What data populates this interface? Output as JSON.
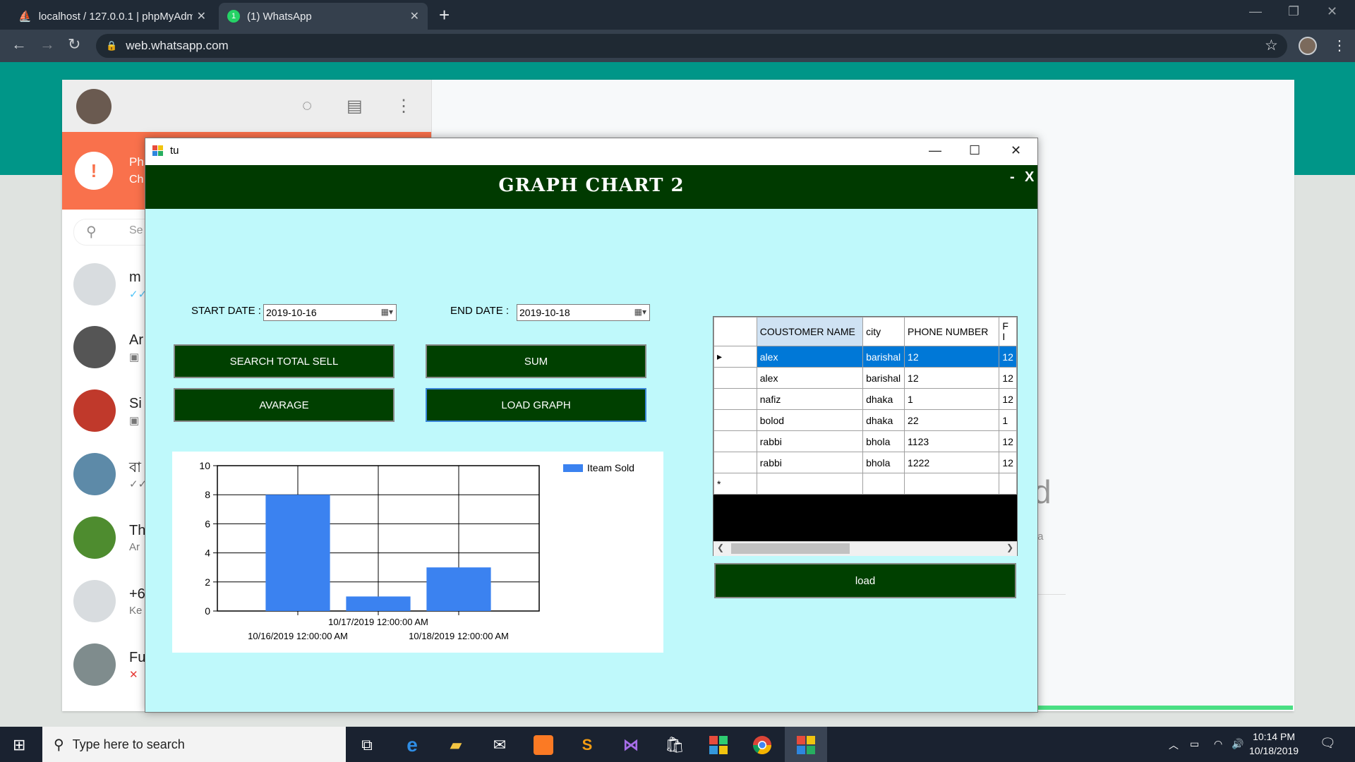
{
  "browser": {
    "tabs": [
      {
        "title": "localhost / 127.0.0.1 | phpMyAdm",
        "active": false
      },
      {
        "title": "(1) WhatsApp",
        "active": true
      }
    ],
    "url": "web.whatsapp.com"
  },
  "whatsapp": {
    "alert": {
      "line1": "Ph",
      "line2": "Ch"
    },
    "search_placeholder": "Se",
    "chats": [
      {
        "name": "m",
        "sub": "✓✓"
      },
      {
        "name": "Ar",
        "sub": "▣"
      },
      {
        "name": "Si",
        "sub": "▣"
      },
      {
        "name": "বা",
        "sub": "✓✓"
      },
      {
        "name": "Th",
        "sub": "Ar"
      },
      {
        "name": "+6",
        "sub": "Ke"
      },
      {
        "name": "Fu",
        "sub": "✕"
      }
    ],
    "right_fragment_1": "d",
    "right_fragment_2": "ta"
  },
  "app_window": {
    "title": "tu",
    "heading": "GRAPH CHART 2",
    "min_label": "-",
    "close_label": "X",
    "start_date_label": "START DATE :",
    "start_date": "2019-10-16",
    "end_date_label": "END DATE  :",
    "end_date": "2019-10-18",
    "buttons": {
      "search_total_sell": "SEARCH TOTAL SELL",
      "sum": "SUM",
      "average": "AVARAGE",
      "load_graph": "LOAD GRAPH",
      "load": "load"
    }
  },
  "chart_data": {
    "type": "bar",
    "categories": [
      "10/16/2019 12:00:00 AM",
      "10/17/2019 12:00:00 AM",
      "10/18/2019 12:00:00 AM"
    ],
    "series": [
      {
        "name": "Iteam Sold",
        "values": [
          8,
          1,
          3
        ],
        "color": "#3b82f0"
      }
    ],
    "yticks": [
      0,
      2,
      4,
      6,
      8,
      10
    ],
    "ylim": [
      0,
      10
    ],
    "grid": true,
    "legend": "top-right"
  },
  "grid": {
    "columns": [
      "COUSTOMER NAME",
      "city",
      "PHONE NUMBER",
      "F I"
    ],
    "rows": [
      [
        "alex",
        "barishal",
        "12",
        "12"
      ],
      [
        "alex",
        "barishal",
        "12",
        "12"
      ],
      [
        "nafiz",
        "dhaka",
        "1",
        "12"
      ],
      [
        "bolod",
        "dhaka",
        "22",
        "1"
      ],
      [
        "rabbi",
        "bhola",
        "1123",
        "12"
      ],
      [
        "rabbi",
        "bhola",
        "1222",
        "12"
      ]
    ],
    "selected_row": 0
  },
  "taskbar": {
    "search_placeholder": "Type here to search",
    "time": "10:14 PM",
    "date": "10/18/2019"
  }
}
